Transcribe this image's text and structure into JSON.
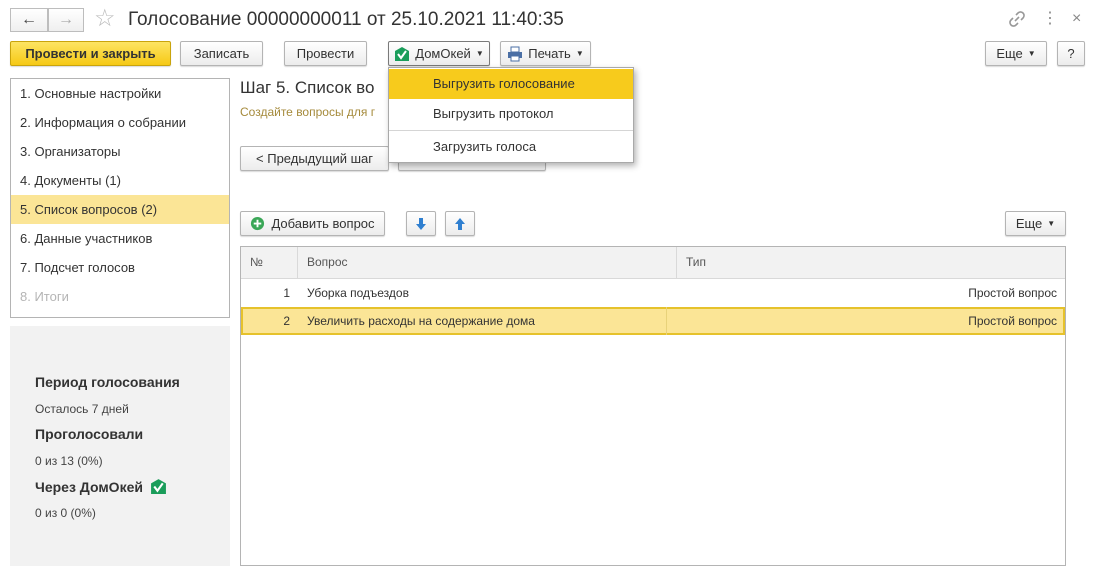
{
  "window": {
    "title": "Голосование 00000000011 от 25.10.2021 11:40:35"
  },
  "toolbar": {
    "post_close": "Провести и закрыть",
    "save": "Записать",
    "post": "Провести",
    "domokey": "ДомОкей",
    "print": "Печать",
    "more": "Еще",
    "help": "?"
  },
  "steps": [
    {
      "label": "1. Основные настройки"
    },
    {
      "label": "2. Информация о собрании"
    },
    {
      "label": "3. Организаторы"
    },
    {
      "label": "4. Документы (1)"
    },
    {
      "label": "5. Список вопросов (2)"
    },
    {
      "label": "6. Данные участников"
    },
    {
      "label": "7. Подсчет голосов"
    },
    {
      "label": "8. Итоги"
    }
  ],
  "info": {
    "period_title": "Период голосования",
    "period_value": "Осталось 7 дней",
    "voted_title": "Проголосовали",
    "voted_value": "0 из 13 (0%)",
    "via_title": "Через ДомОкей",
    "via_value": "0 из 0 (0%)"
  },
  "main": {
    "step_title": "Шаг 5. Список во",
    "step_hint": "Создайте вопросы для г",
    "prev_step": "< Предыдущий шаг",
    "add_question": "Добавить вопрос",
    "more": "Еще"
  },
  "table": {
    "columns": [
      "№",
      "Вопрос",
      "Тип"
    ],
    "rows": [
      {
        "num": "1",
        "question": "Уборка подъездов",
        "type": "Простой вопрос"
      },
      {
        "num": "2",
        "question": "Увеличить расходы на содержание дома",
        "type": "Простой вопрос"
      }
    ]
  },
  "dropdown": {
    "items": [
      {
        "label": "Выгрузить голосование"
      },
      {
        "label": "Выгрузить протокол"
      },
      {
        "label": "Загрузить голоса"
      }
    ]
  },
  "colors": {
    "accent_yellow": "#f6c915",
    "selection": "#fbe596",
    "menu_highlight": "#f7cb1c",
    "domokey_green": "#1a9d5a"
  }
}
